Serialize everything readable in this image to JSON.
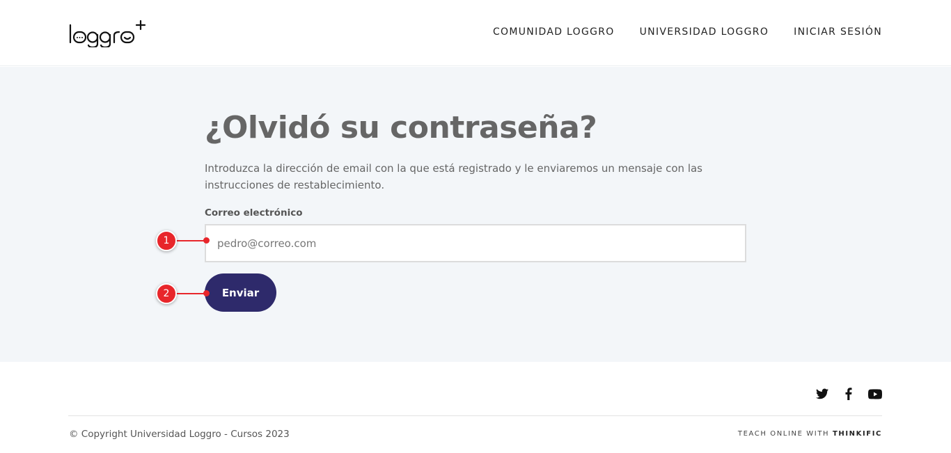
{
  "header": {
    "logo_text": "loggro+",
    "nav": [
      {
        "label": "COMUNIDAD LOGGRO"
      },
      {
        "label": "UNIVERSIDAD LOGGRO"
      },
      {
        "label": "INICIAR SESIÓN"
      }
    ]
  },
  "form": {
    "title": "¿Olvidó su contraseña?",
    "description": "Introduzca la dirección de email con la que está registrado y le enviaremos un mensaje con las instrucciones de restablecimiento.",
    "email_label": "Correo electrónico",
    "email_placeholder": "pedro@correo.com",
    "email_value": "",
    "submit_label": "Enviar"
  },
  "annotations": [
    {
      "number": "1"
    },
    {
      "number": "2"
    }
  ],
  "footer": {
    "social_icons": [
      "twitter-icon",
      "facebook-icon",
      "youtube-icon"
    ],
    "copyright": "© Copyright Universidad Loggro - Cursos 2023",
    "teach_prefix": "TEACH ONLINE WITH",
    "teach_brand": "THINKIFIC"
  },
  "colors": {
    "accent": "#2e2a6b",
    "marker": "#e8262b",
    "background": "#f3f6f9"
  }
}
